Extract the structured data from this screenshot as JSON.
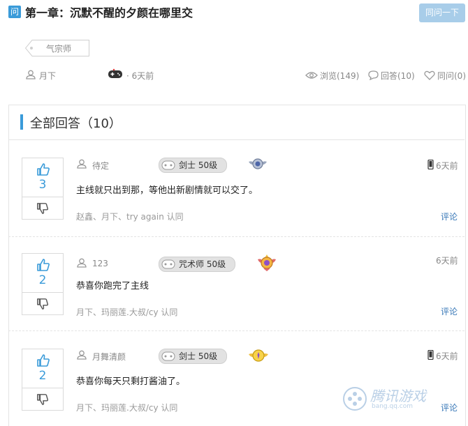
{
  "question": {
    "badge": "问",
    "title": "第一章：沉默不醒的夕颜在哪里交",
    "ask_button": "同问一下",
    "tag": "气宗师",
    "author": "月下",
    "time": "6天前",
    "views": "浏览(149)",
    "answers": "回答(10)",
    "same_question": "同问(0)"
  },
  "panel": {
    "title": "全部回答（10）"
  },
  "answers": [
    {
      "votes": "3",
      "user": "待定",
      "level": "剑士 50级",
      "content": "主线就只出到那，等他出新剧情就可以交了。",
      "likers": "赵鑫、月下、try again 认同",
      "comment": "评论",
      "time": "6天前",
      "device": "phone-icon"
    },
    {
      "votes": "2",
      "user": "123",
      "level": "咒术师 50级",
      "content": "恭喜你跑完了主线",
      "likers": "月下、玛丽莲.大叔/cy 认同",
      "comment": "评论",
      "time": "6天前",
      "device": ""
    },
    {
      "votes": "2",
      "user": "月舞清颜",
      "level": "剑士 50级",
      "content": "恭喜你每天只剩打酱油了。",
      "likers": "月下、玛丽莲.大叔/cy 认同",
      "comment": "评论",
      "time": "6天前",
      "device": "phone-icon"
    }
  ],
  "watermark": {
    "text": "腾讯游戏",
    "sub": "bang.qq.com"
  },
  "colors": {
    "accent": "#3a9bd9",
    "button_disabled": "#a8cde9",
    "link": "#3a79b8"
  }
}
